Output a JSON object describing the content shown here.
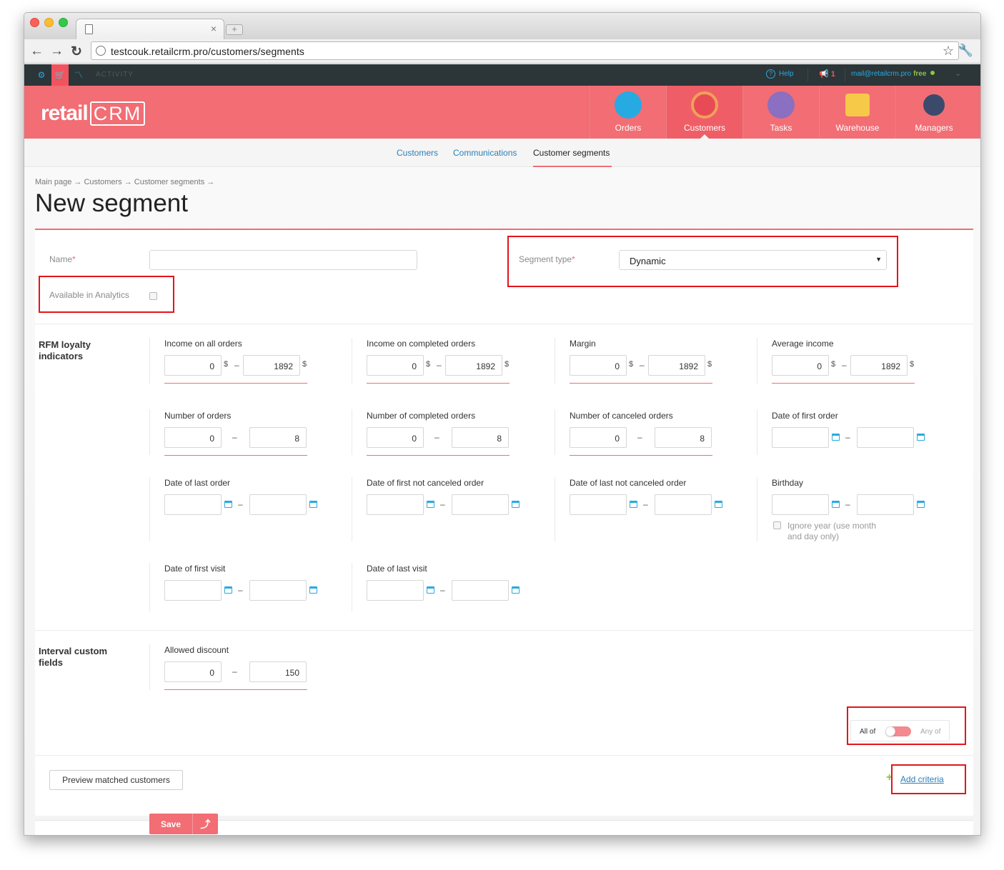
{
  "browser": {
    "url": "testcouk.retailcrm.pro/customers/segments",
    "tab_close": "×",
    "new_tab": "+",
    "back": "←",
    "forward": "→",
    "reload": "↻",
    "star": "☆",
    "wrench": "🔧"
  },
  "topbar": {
    "activity": "ACTIVITY",
    "help": "Help",
    "notify_count": "1",
    "email": "mail@retailcrm.pro",
    "plan": "free"
  },
  "logo": {
    "part1": "retail",
    "part2": "CRM"
  },
  "mainnav": [
    {
      "label": "Orders",
      "icon": "cart-icon",
      "color": "#27aae1"
    },
    {
      "label": "Customers",
      "icon": "customer-avatar-icon",
      "color": "#f0a05a"
    },
    {
      "label": "Tasks",
      "icon": "tasks-icon",
      "color": "#8b6fc0"
    },
    {
      "label": "Warehouse",
      "icon": "box-icon",
      "color": "#f7c948"
    },
    {
      "label": "Managers",
      "icon": "manager-avatar-icon",
      "color": "#3b4a6b"
    }
  ],
  "subnav": {
    "customers": "Customers",
    "communications": "Communications",
    "segments": "Customer segments"
  },
  "breadcrumb": "Main page → Customers → Customer segments →",
  "page_title": "New segment",
  "form": {
    "name_label": "Name",
    "required_mark": "*",
    "segment_type_label": "Segment type",
    "segment_type_value": "Dynamic",
    "analytics_label": "Available in Analytics"
  },
  "rfm": {
    "title_line1": "RFM loyalty",
    "title_line2": "indicators",
    "currency": "$",
    "dash": "–",
    "income_all": {
      "label": "Income on all orders",
      "from": "0",
      "to": "1892"
    },
    "income_completed": {
      "label": "Income on completed orders",
      "from": "0",
      "to": "1892"
    },
    "margin": {
      "label": "Margin",
      "from": "0",
      "to": "1892"
    },
    "avg_income": {
      "label": "Average income",
      "from": "0",
      "to": "1892"
    },
    "num_orders": {
      "label": "Number of orders",
      "from": "0",
      "to": "8"
    },
    "num_completed": {
      "label": "Number of completed orders",
      "from": "0",
      "to": "8"
    },
    "num_canceled": {
      "label": "Number of canceled orders",
      "from": "0",
      "to": "8"
    },
    "date_first_order": {
      "label": "Date of first order"
    },
    "date_last_order": {
      "label": "Date of last order"
    },
    "date_first_not_canceled": {
      "label": "Date of first not canceled order"
    },
    "date_last_not_canceled": {
      "label": "Date of last not canceled order"
    },
    "birthday": {
      "label": "Birthday",
      "note_line1": "Ignore year (use month",
      "note_line2": "and day only)"
    },
    "date_first_visit": {
      "label": "Date of first visit"
    },
    "date_last_visit": {
      "label": "Date of last visit"
    }
  },
  "interval": {
    "title_line1": "Interval custom",
    "title_line2": "fields",
    "allowed_discount": {
      "label": "Allowed discount",
      "from": "0",
      "to": "150"
    }
  },
  "toggle": {
    "all_of": "All of",
    "any_of": "Any of"
  },
  "buttons": {
    "preview": "Preview matched customers",
    "add_criteria": "Add criteria",
    "add_plus": "+",
    "save": "Save",
    "save_more": "⤴"
  }
}
